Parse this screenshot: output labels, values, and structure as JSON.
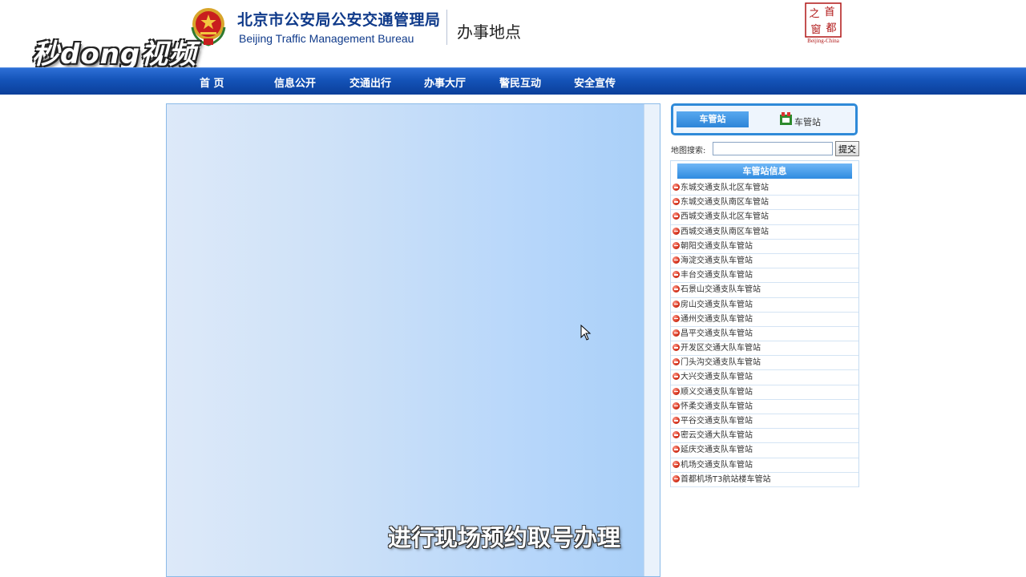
{
  "watermark": "秒dong视频",
  "header": {
    "bureau_cn": "北京市公安局公安交通管理局",
    "bureau_en": "Beijing Traffic Management Bureau",
    "page_heading": "办事地点",
    "capital_logo_text": [
      "首",
      "都",
      "之",
      "窗"
    ],
    "capital_logo_en": "Beijing-China"
  },
  "nav": {
    "items": [
      "首 页",
      "信息公开",
      "交通出行",
      "办事大厅",
      "警民互动",
      "安全宣传"
    ]
  },
  "tabs": {
    "active": "车管站",
    "inactive": "车管站"
  },
  "search": {
    "label": "地图搜索:",
    "value": "",
    "button": "提交"
  },
  "stations": {
    "header": "车管站信息",
    "items": [
      "东城交通支队北区车管站",
      "东城交通支队南区车管站",
      "西城交通支队北区车管站",
      "西城交通支队南区车管站",
      "朝阳交通支队车管站",
      "海淀交通支队车管站",
      "丰台交通支队车管站",
      "石景山交通支队车管站",
      "房山交通支队车管站",
      "通州交通支队车管站",
      "昌平交通支队车管站",
      "开发区交通大队车管站",
      "门头沟交通支队车管站",
      "大兴交通支队车管站",
      "顺义交通支队车管站",
      "怀柔交通支队车管站",
      "平谷交通支队车管站",
      "密云交通大队车管站",
      "延庆交通支队车管站",
      "机场交通支队车管站",
      "首都机场T3航站楼车管站"
    ]
  },
  "subtitle": "进行现场预约取号办理",
  "colors": {
    "nav_blue": "#1453b8",
    "title_blue": "#0f3a8a",
    "tab_border": "#2f8ad8",
    "marker_red": "#d4321c"
  }
}
